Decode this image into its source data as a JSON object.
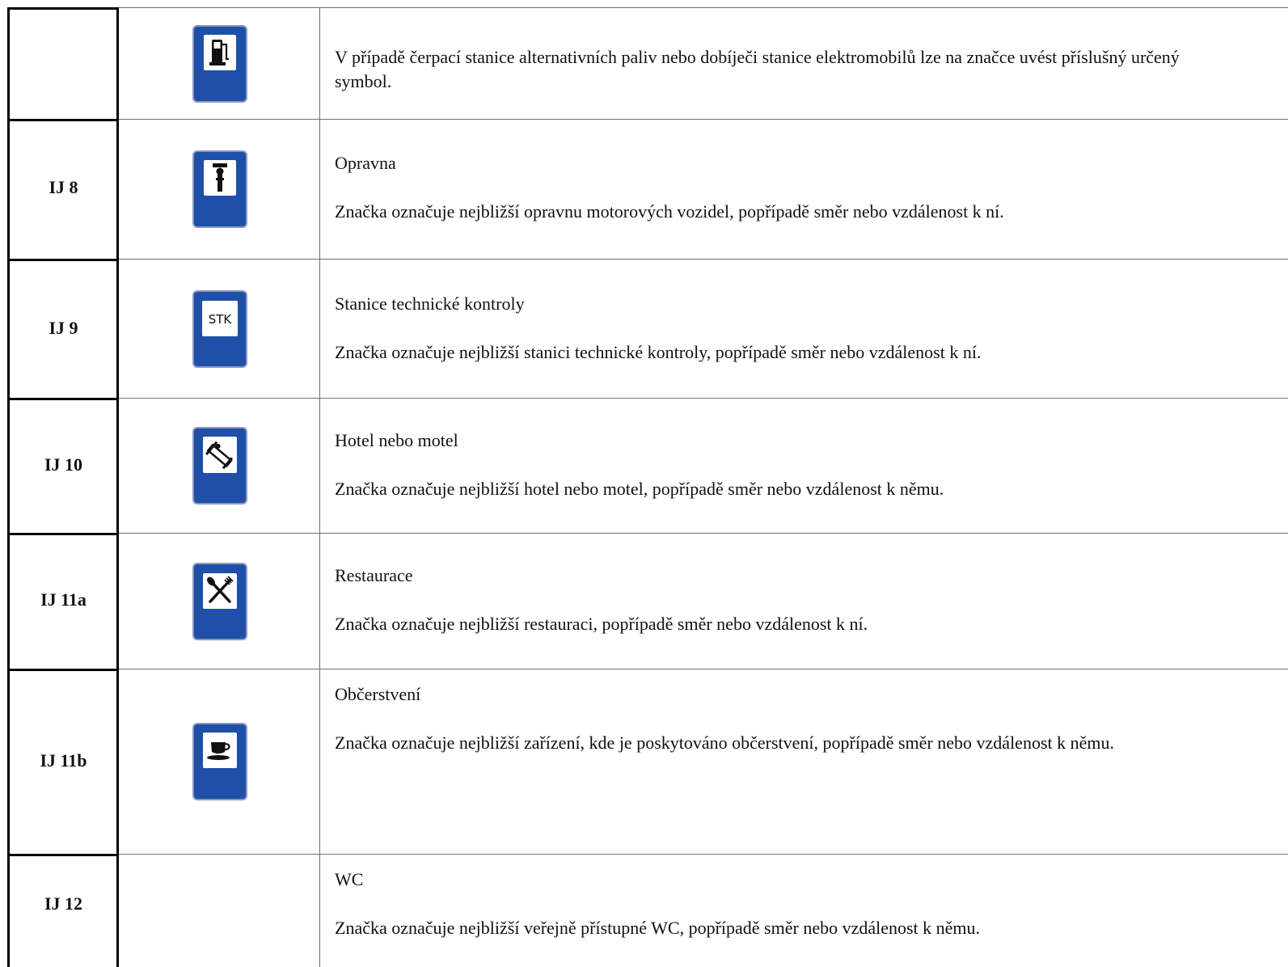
{
  "rows": [
    {
      "code": "",
      "sign_icon": "fuel-station-sign-icon",
      "title": "",
      "text": "V případě čerpací stanice alternativních paliv nebo dobíječi stanice elektromobilů lze na značce uvést příslušný určený symbol."
    },
    {
      "code": "IJ 8",
      "sign_icon": "repair-shop-sign-icon",
      "title": "Opravna",
      "text": "Značka označuje nejbližší opravnu motorových vozidel, popřípadě směr nebo vzdálenost k ní."
    },
    {
      "code": "IJ 9",
      "sign_icon": "stk-sign-icon",
      "sign_text": "STK",
      "title": "Stanice technické kontroly",
      "text": "Značka označuje nejbližší stanici technické kontroly, popřípadě směr nebo vzdálenost k ní."
    },
    {
      "code": "IJ 10",
      "sign_icon": "hotel-bed-sign-icon",
      "title": "Hotel nebo motel",
      "text": "Značka označuje nejbližší hotel nebo motel, popřípadě směr nebo vzdálenost k němu."
    },
    {
      "code": "IJ 11a",
      "sign_icon": "restaurant-sign-icon",
      "title": "Restaurace",
      "text": "Značka označuje nejbližší restauraci, popřípadě směr nebo vzdálenost k ní."
    },
    {
      "code": "IJ 11b",
      "sign_icon": "refreshment-cup-sign-icon",
      "title": "Občerstvení",
      "text": "Značka označuje nejbližší zařízení, kde je poskytováno občerstvení, popřípadě směr nebo vzdálenost k němu."
    },
    {
      "code": "IJ 12",
      "sign_icon": "",
      "title": "WC",
      "text": "Značka označuje nejbližší veřejně přístupné WC, popřípadě směr nebo vzdálenost k němu."
    }
  ],
  "colors": {
    "sign_blue": "#1f4fa8",
    "sign_white": "#ffffff",
    "symbol_black": "#111111"
  }
}
